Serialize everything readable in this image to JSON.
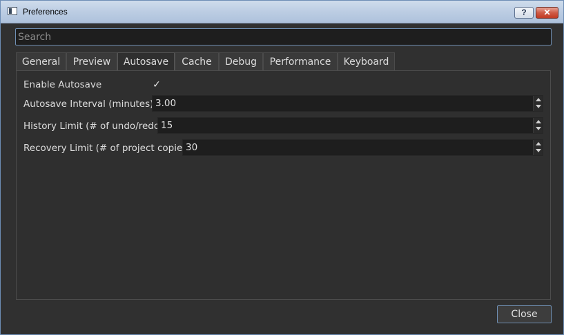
{
  "window": {
    "title": "Preferences",
    "help_label": "?",
    "close_label": "✕"
  },
  "search": {
    "placeholder": "Search"
  },
  "tabs": [
    {
      "label": "General"
    },
    {
      "label": "Preview"
    },
    {
      "label": "Autosave",
      "active": true
    },
    {
      "label": "Cache"
    },
    {
      "label": "Debug"
    },
    {
      "label": "Performance"
    },
    {
      "label": "Keyboard"
    }
  ],
  "autosave": {
    "enable_label": "Enable Autosave",
    "enable_checked_glyph": "✓",
    "interval_label": "Autosave Interval (minutes)",
    "interval_value": "3.00",
    "history_label": "History Limit (# of undo/redo)",
    "history_value": "15",
    "recovery_label": "Recovery Limit (# of project copies)",
    "recovery_value": "30"
  },
  "footer": {
    "close_label": "Close"
  },
  "colors": {
    "background": "#2b2b2b",
    "panel": "#2f2f2f",
    "field": "#1e1e1e",
    "accent_border": "#6f8fb3",
    "text": "#dcdcdc"
  },
  "icons": {
    "app": "preferences-window-icon",
    "help": "help-icon",
    "close": "close-icon"
  }
}
